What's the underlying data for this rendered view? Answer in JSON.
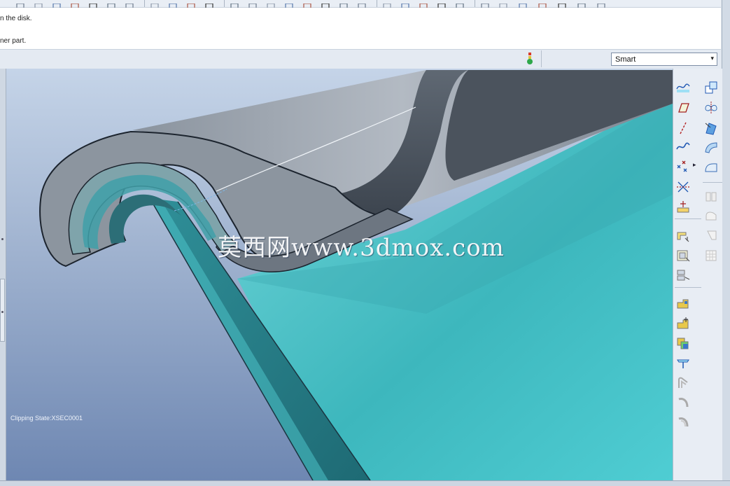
{
  "messages": {
    "line1": "n the disk.",
    "line2": "ner part."
  },
  "filter": {
    "selected": "Smart",
    "chevron": "▾"
  },
  "viewport": {
    "clipping_state": "Clipping State:XSEC0001",
    "watermark": "莫西网www.3dmox.com",
    "colors": {
      "background_top": "#c5d4e8",
      "background_bottom": "#6e87b2",
      "sheet_teal": "#45c8cf",
      "tube_gray": "#9aa3ad"
    }
  },
  "toolbar": {
    "icons": [
      "layer-icon",
      "copy-icon",
      "paste-icon",
      "window-icon",
      "list-icon",
      "tree-icon",
      "binoculars-icon",
      "dotted-box-icon",
      "plane-display-icon",
      "axis-display-icon",
      "spin-icon",
      "sphere-icon",
      "hand-icon",
      "zoom-in-icon",
      "zoom-out-icon",
      "zoom-fit-icon",
      "refit-icon",
      "orient-icon",
      "view-manager-icon",
      "saved-views-icon",
      "shade-icon",
      "wireframe-icon",
      "hidden-line-icon",
      "no-hidden-icon",
      "shaded-icon",
      "datum-plane-icon",
      "datum-axis-icon",
      "datum-point-icon",
      "coord-sys-icon",
      "annotation-icon",
      "pointer-icon"
    ]
  },
  "tools": {
    "left_column": [
      "sketch-icon",
      "plane-icon",
      "axis-icon",
      "curve-icon",
      "point-icon",
      "csys-icon",
      "analysis-icon",
      "flange-icon",
      "unbend-icon",
      "bend-back-icon",
      "wall-icon",
      "extrude-wall-icon",
      "pattern-icon",
      "rip-icon",
      "corner-relief-icon",
      "form-icon",
      "flatten-icon",
      "edge-bend-icon"
    ],
    "right_column": [
      "copy-feature-icon",
      "mirror-icon",
      "extend-icon",
      "merge-icon",
      "fill-icon",
      "split-icon",
      "round-icon",
      "chamfer-icon",
      "table-icon"
    ],
    "more_indicator": "▸"
  }
}
